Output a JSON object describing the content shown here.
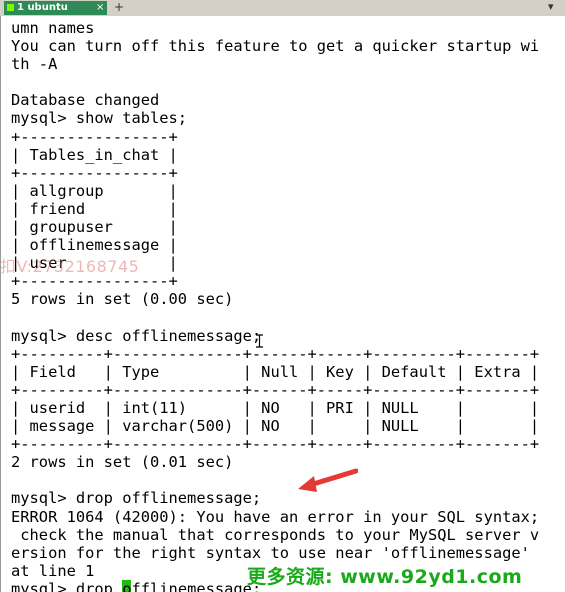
{
  "tab": {
    "label": "1 ubuntu",
    "close": "×",
    "new_tab": "+",
    "window_controls": "▾"
  },
  "terminal": {
    "lines": [
      "umn names",
      "You can turn off this feature to get a quicker startup wi",
      "th -A",
      "",
      "Database changed",
      "mysql> show tables;",
      "+----------------+",
      "| Tables_in_chat |",
      "+----------------+",
      "| allgroup       |",
      "| friend         |",
      "| groupuser      |",
      "| offlinemessage |",
      "| user           |",
      "+----------------+",
      "5 rows in set (0.00 sec)",
      "",
      "mysql> desc offlinemessage;",
      "+---------+--------------+------+-----+---------+-------+",
      "| Field   | Type         | Null | Key | Default | Extra |",
      "+---------+--------------+------+-----+---------+-------+",
      "| userid  | int(11)      | NO   | PRI | NULL    |       |",
      "| message | varchar(500) | NO   |     | NULL    |       |",
      "+---------+--------------+------+-----+---------+-------+",
      "2 rows in set (0.01 sec)",
      "",
      "mysql> drop offlinemessage;",
      "ERROR 1064 (42000): You have an error in your SQL syntax;",
      " check the manual that corresponds to your MySQL server v",
      "ersion for the right syntax to use near 'offlinemessage'",
      "at line 1"
    ],
    "last_line_prefix": "mysql> drop ",
    "last_line_cursor_char": "o",
    "last_line_suffix": "fflinemessage;"
  },
  "watermarks": {
    "left_contact": "扣V:2732168745",
    "bottom_site": "更多资源: www.92yd1.com"
  },
  "colors": {
    "tab_background": "#2e8b57",
    "cursor": "#22b814",
    "arrow": "#e53935",
    "watermark_site": "#1aa91a"
  }
}
